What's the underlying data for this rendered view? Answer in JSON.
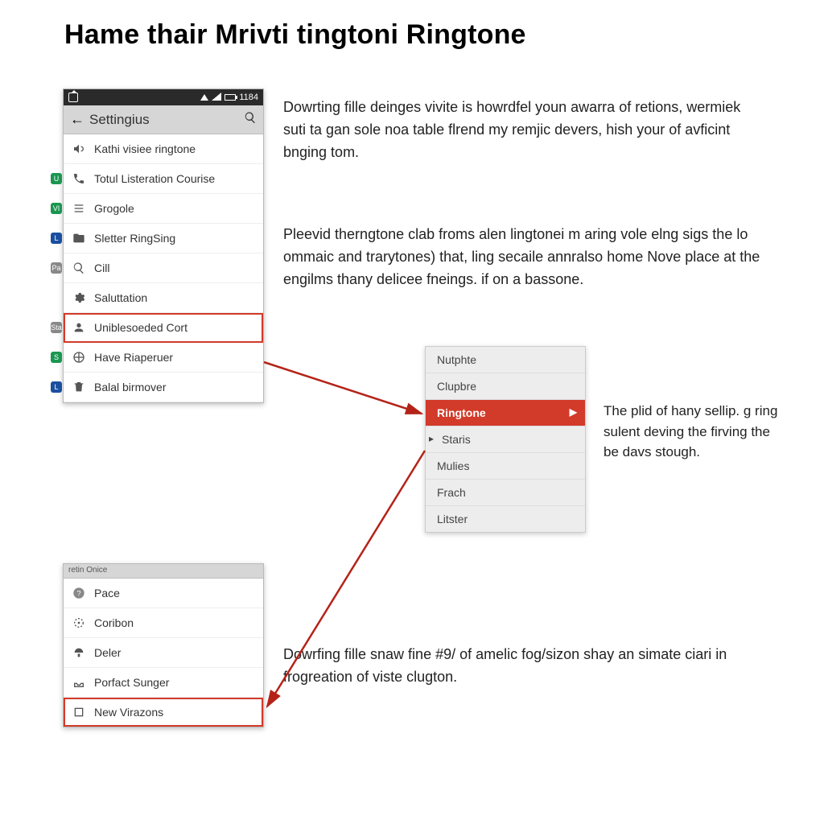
{
  "page": {
    "title": "Hame thair Mrivti tingtoni Ringtone"
  },
  "phone1": {
    "status": {
      "time": "1184"
    },
    "titlebar": {
      "title": "Settingius"
    },
    "items": [
      {
        "label": "Kathi visiee ringtone",
        "icon": "vol-icon",
        "badge": null
      },
      {
        "label": "Totul Listeration Courise",
        "icon": "phone-icon",
        "badge": "U",
        "badge_color": "#1a9650"
      },
      {
        "label": "Grogole",
        "icon": "list-icon",
        "badge": "VI",
        "badge_color": "#1a9650"
      },
      {
        "label": "Sletter RingSing",
        "icon": "folder-icon",
        "badge": "L",
        "badge_color": "#1a4fa0"
      },
      {
        "label": "Cill",
        "icon": "search-icon",
        "badge": "Pa",
        "badge_color": "#888"
      },
      {
        "label": "Saluttation",
        "icon": "gear-icon",
        "badge": null
      },
      {
        "label": "Uniblesoeded Cort",
        "icon": "person-icon",
        "badge": "Sta",
        "badge_color": "#888",
        "highlight": true
      },
      {
        "label": "Have Riaperuer",
        "icon": "globe-icon",
        "badge": "S",
        "badge_color": "#1a9650"
      },
      {
        "label": "Balal birmover",
        "icon": "trash-icon",
        "badge": "L",
        "badge_color": "#1a4fa0"
      }
    ]
  },
  "phone2": {
    "header_hint": "retin Onice",
    "items": [
      {
        "label": "Pace",
        "icon": "help-icon"
      },
      {
        "label": "Coribon",
        "icon": "target-icon"
      },
      {
        "label": "Deler",
        "icon": "mushroom-icon"
      },
      {
        "label": "Porfact Sunger",
        "icon": "tray-icon"
      },
      {
        "label": "New Virazons",
        "icon": "square-icon",
        "highlight": true
      }
    ]
  },
  "dropdown": {
    "items": [
      {
        "label": "Nutphte"
      },
      {
        "label": "Clupbre"
      },
      {
        "label": "Ringtone",
        "selected": true
      },
      {
        "label": "Staris",
        "caret": true
      },
      {
        "label": "Mulies"
      },
      {
        "label": "Frach"
      },
      {
        "label": "Litster"
      }
    ]
  },
  "paragraphs": {
    "p1": "Dowrting fille deinges vivite is howrdfel youn awarra of retions, wermiek suti ta gan sole noa table flrend my remjic devers, hish your of avficint bnging tom.",
    "p2": "Pleevid therngtone clab froms alen lingtonei m aring vole elng sigs the lo ommaic and trarytones) that, ling secaile annralso home Nove place at the engilms thany delicee fneings. if on a bassone.",
    "caption": "The plid of hany sellip. g ring sulent deving the firving the be davs stough.",
    "p3": "Dowrfing fille snaw fine #9/ of amelic fog/sizon shay an simate ciari in frogreation of viste clugton."
  },
  "colors": {
    "accent_red": "#d23a2a"
  }
}
